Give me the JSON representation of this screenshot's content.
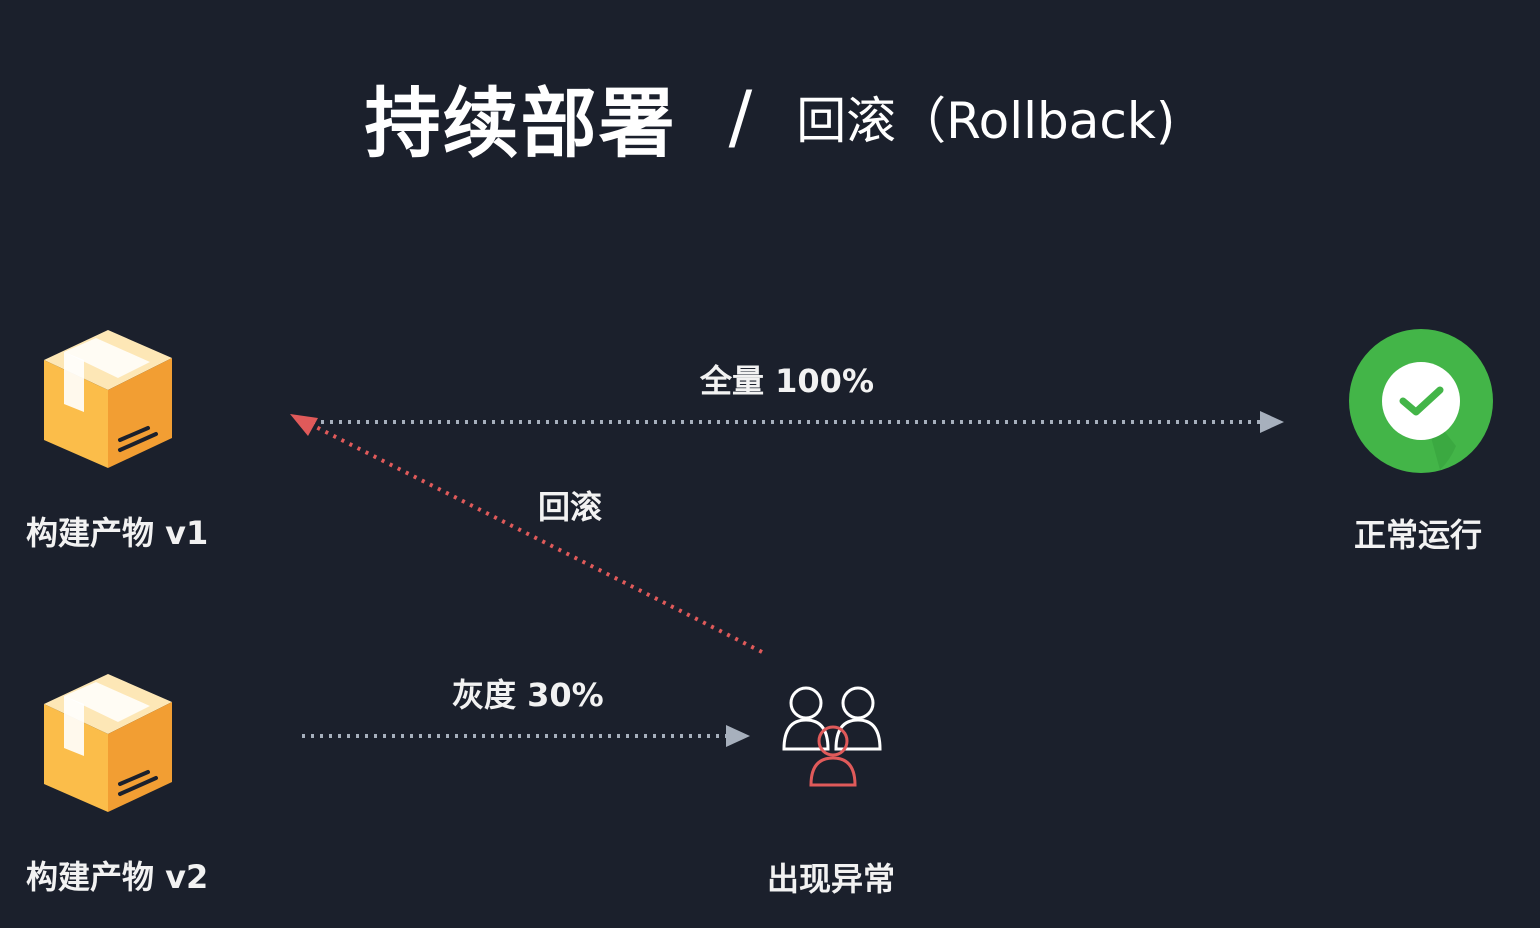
{
  "title": {
    "main": "持续部署",
    "separator": "/",
    "sub": "回滚（Rollback)"
  },
  "nodes": {
    "artifact_v1": {
      "label": "构建产物 v1",
      "icon": "package-box-icon"
    },
    "artifact_v2": {
      "label": "构建产物 v2",
      "icon": "package-box-icon"
    },
    "success": {
      "label": "正常运行",
      "icon": "check-circle-icon"
    },
    "anomaly": {
      "label": "出现异常",
      "icon": "users-alert-icon"
    }
  },
  "edges": {
    "full_release": {
      "label": "全量 100%"
    },
    "rollback": {
      "label": "回滚"
    },
    "canary": {
      "label": "灰度 30%"
    }
  },
  "colors": {
    "background": "#1b202c",
    "box": "#fbbd4a",
    "box_dark": "#f29e33",
    "box_tape": "#fde7b6",
    "success_green": "#43b548",
    "rollback_red": "#e05a5a",
    "arrow_grey": "#a7b0bd"
  }
}
